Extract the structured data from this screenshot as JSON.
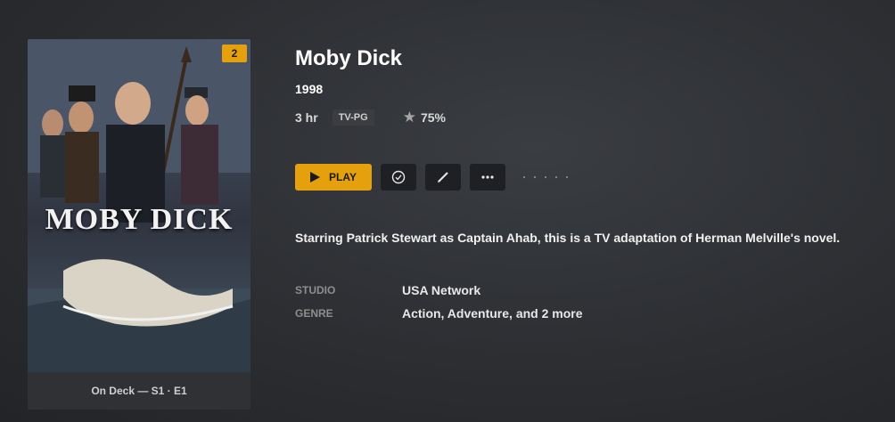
{
  "poster": {
    "title_art": "MOBY DICK",
    "badge_count": "2",
    "footer": "On Deck — S1 · E1"
  },
  "movie": {
    "title": "Moby Dick",
    "year": "1998",
    "duration": "3 hr",
    "content_rating": "TV-PG",
    "audience_rating": "75%",
    "summary": "Starring Patrick Stewart as Captain Ahab, this is a TV adaptation of Herman Melville's novel."
  },
  "actions": {
    "play_label": "PLAY",
    "icons": [
      "check-circle-icon",
      "pencil-icon",
      "more-icon"
    ]
  },
  "info": {
    "studio_label": "STUDIO",
    "studio_value": "USA Network",
    "genre_label": "GENRE",
    "genre_value": "Action, Adventure, and 2 more"
  },
  "colors": {
    "accent": "#e5a00d",
    "background": "#2c2e32"
  }
}
